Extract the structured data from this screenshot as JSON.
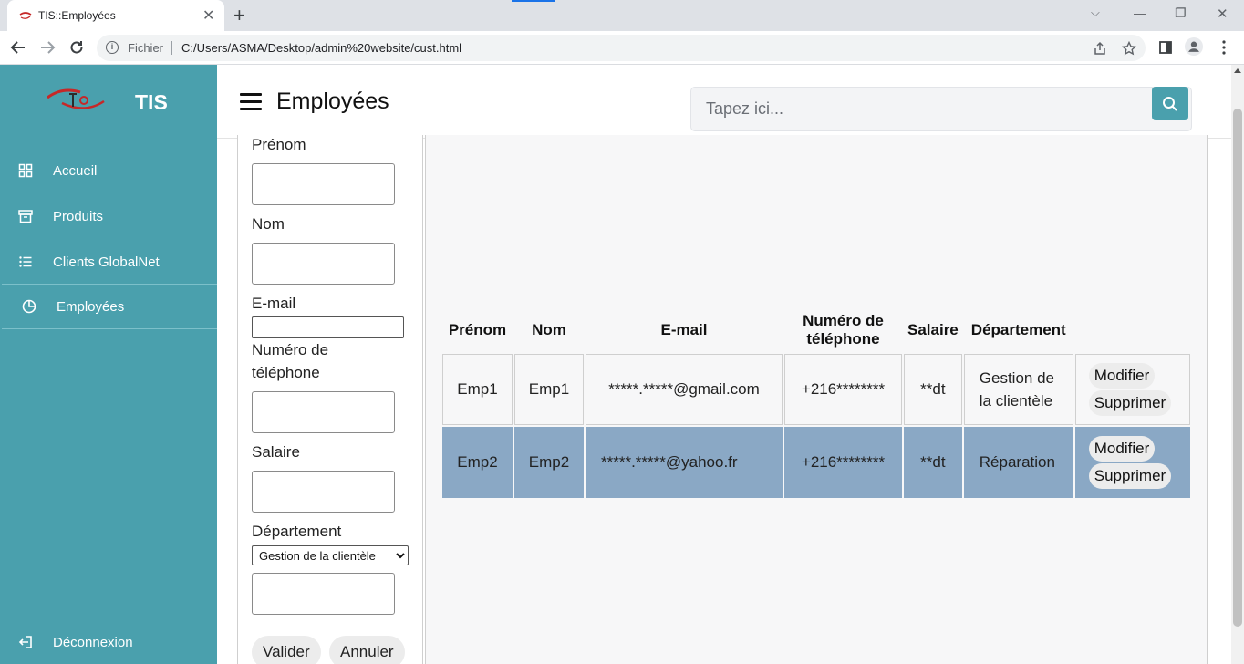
{
  "browser": {
    "tab_title": "TIS::Employées",
    "site_label": "Fichier",
    "url": "C:/Users/ASMA/Desktop/admin%20website/cust.html",
    "new_tab": "+",
    "close": "✕",
    "minimize": "—",
    "restore": "❐",
    "window_close": "✕"
  },
  "sidebar": {
    "brand": "TIS",
    "items": [
      {
        "label": "Accueil",
        "icon": "grid-icon"
      },
      {
        "label": "Produits",
        "icon": "archive-icon"
      },
      {
        "label": "Clients GlobalNet",
        "icon": "list-icon"
      },
      {
        "label": "Employées",
        "icon": "pie-chart-icon",
        "active": true
      }
    ],
    "logout": {
      "label": "Déconnexion",
      "icon": "logout-icon"
    },
    "color": "#4aa0ad"
  },
  "header": {
    "title": "Employées",
    "search_placeholder": "Tapez ici..."
  },
  "form": {
    "prenom_label": "Prénom",
    "nom_label": "Nom",
    "email_label": "E-mail",
    "phone_label": "Numéro de téléphone",
    "phone_label_line1": "Numéro de",
    "phone_label_line2": "téléphone",
    "salaire_label": "Salaire",
    "departement_label": "Département",
    "departement_selected": "Gestion de la clientèle",
    "submit_label": "Valider",
    "cancel_label": "Annuler"
  },
  "table": {
    "headers": [
      "Prénom",
      "Nom",
      "E-mail",
      "Numéro de téléphone",
      "Salaire",
      "Département",
      ""
    ],
    "rows": [
      {
        "prenom": "Emp1",
        "nom": "Emp1",
        "email": "*****.*****@gmail.com",
        "phone": "+216********",
        "salaire": "**dt",
        "departement": "Gestion de la clientèle"
      },
      {
        "prenom": "Emp2",
        "nom": "Emp2",
        "email": "*****.*****@yahoo.fr",
        "phone": "+216********",
        "salaire": "**dt",
        "departement": "Réparation"
      }
    ],
    "edit_label": "Modifier",
    "delete_label": "Supprimer",
    "highlight_color": "#8aa8c5"
  }
}
